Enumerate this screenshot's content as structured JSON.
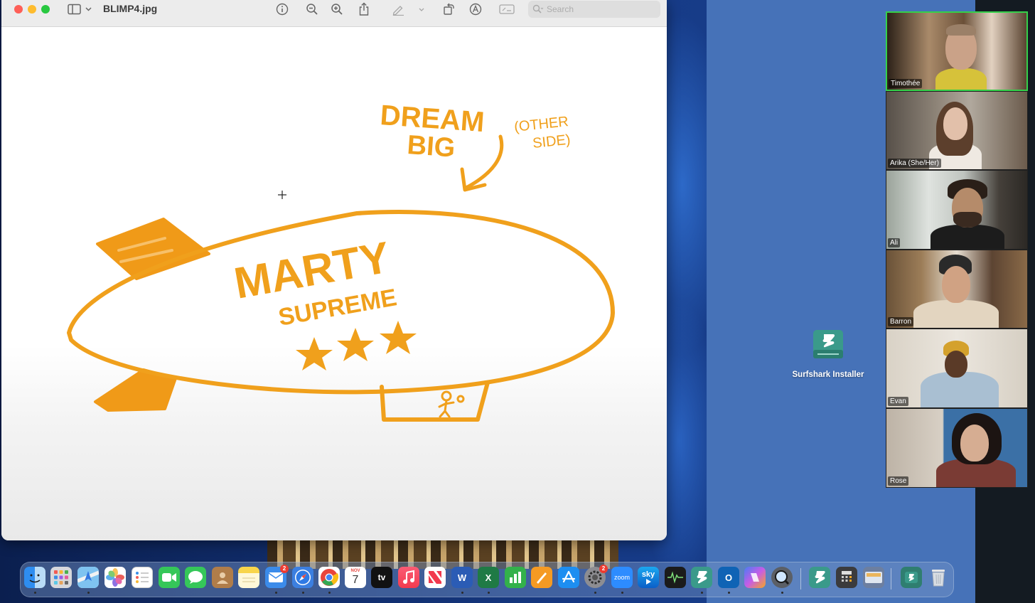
{
  "window": {
    "title": "BLIMP4.jpg",
    "search_placeholder": "Search"
  },
  "drawing": {
    "headline_line1": "DREAM",
    "headline_line2": "BIG",
    "side_note_line1": "(OTHER",
    "side_note_line2": "SIDE)",
    "blimp_title": "MARTY",
    "blimp_subtitle": "SUPREME",
    "ink_color": "#f0a01c"
  },
  "desktop": {
    "installer_label": "Surfshark Installer"
  },
  "participants": [
    {
      "name": "Timothée",
      "active": true
    },
    {
      "name": "Arika (She/Her)",
      "active": false
    },
    {
      "name": "Ali",
      "active": false
    },
    {
      "name": "Barron",
      "active": false
    },
    {
      "name": "Evan",
      "active": false
    },
    {
      "name": "Rose",
      "active": false
    }
  ],
  "dock": {
    "mail_badge": "2",
    "calendar_month": "NOV",
    "calendar_day": "7",
    "settings_badge": "2",
    "tv_label": "tv",
    "zoom_label": "zoom",
    "sky_label": "sky",
    "word_label": "W",
    "excel_label": "X",
    "outlook_label": "O"
  }
}
